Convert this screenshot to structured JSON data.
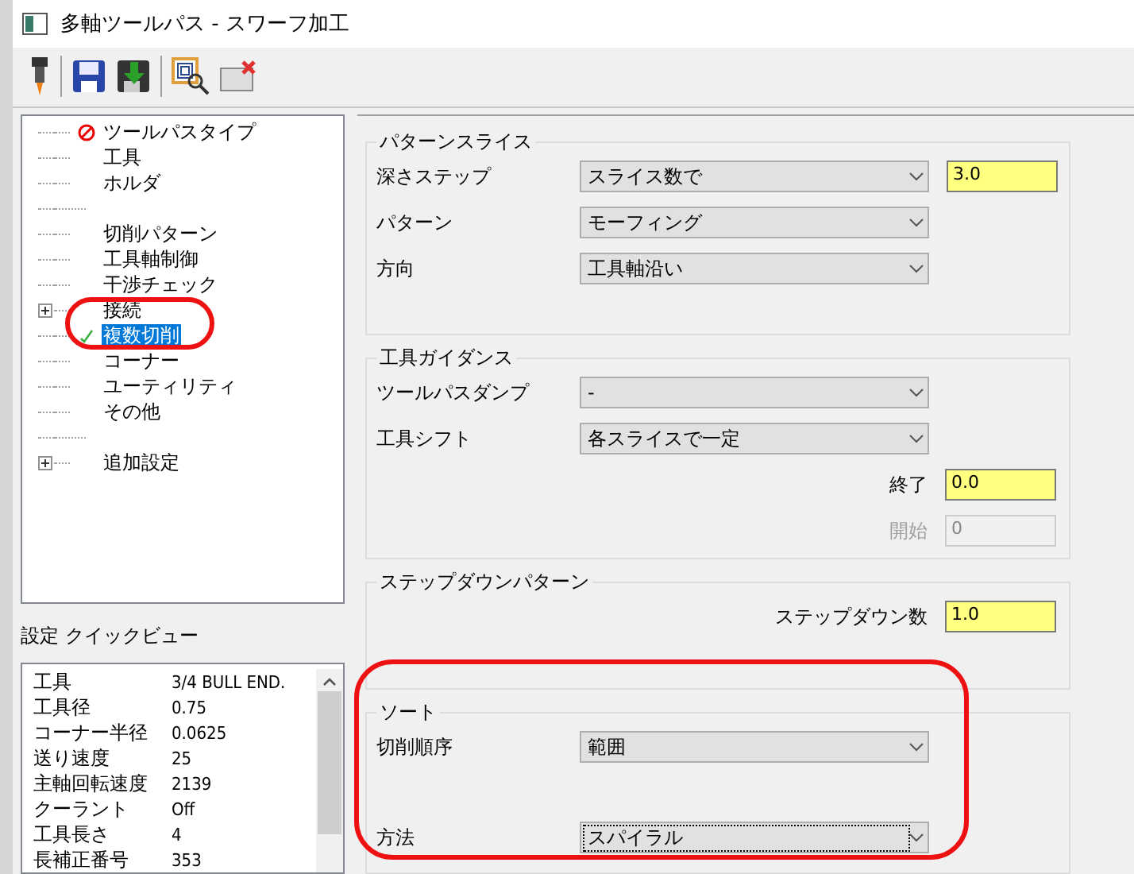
{
  "window": {
    "title": "多軸ツールパス - スワーフ加工"
  },
  "tree": {
    "items": [
      {
        "kind": "item",
        "label": "ツールパスタイプ",
        "invalid": true,
        "checked": false,
        "expandable": false,
        "selected": false
      },
      {
        "kind": "item",
        "label": "工具",
        "invalid": false,
        "checked": false,
        "expandable": false,
        "selected": false
      },
      {
        "kind": "item",
        "label": "ホルダ",
        "invalid": false,
        "checked": false,
        "expandable": false,
        "selected": false
      },
      {
        "kind": "blank",
        "expandable": false,
        "selected": false
      },
      {
        "kind": "item",
        "label": "切削パターン",
        "invalid": false,
        "checked": false,
        "expandable": false,
        "selected": false
      },
      {
        "kind": "item",
        "label": "工具軸制御",
        "invalid": false,
        "checked": false,
        "expandable": false,
        "selected": false
      },
      {
        "kind": "item",
        "label": "干渉チェック",
        "invalid": false,
        "checked": false,
        "expandable": false,
        "selected": false
      },
      {
        "kind": "item",
        "label": "接続",
        "invalid": false,
        "checked": false,
        "expandable": true,
        "selected": false
      },
      {
        "kind": "item",
        "label": "複数切削",
        "invalid": false,
        "checked": true,
        "expandable": false,
        "selected": true
      },
      {
        "kind": "item",
        "label": "コーナー",
        "invalid": false,
        "checked": false,
        "expandable": false,
        "selected": false
      },
      {
        "kind": "item",
        "label": "ユーティリティ",
        "invalid": false,
        "checked": false,
        "expandable": false,
        "selected": false
      },
      {
        "kind": "item",
        "label": "その他",
        "invalid": false,
        "checked": false,
        "expandable": false,
        "selected": false
      },
      {
        "kind": "blank",
        "expandable": false,
        "selected": false
      },
      {
        "kind": "item",
        "label": "追加設定",
        "invalid": false,
        "checked": false,
        "expandable": true,
        "selected": false
      }
    ]
  },
  "quick_view": {
    "title": "設定 クイックビュー",
    "rows": [
      {
        "name": "工具",
        "value": "3/4 BULL END."
      },
      {
        "name": "工具径",
        "value": "0.75"
      },
      {
        "name": "コーナー半径",
        "value": "0.0625"
      },
      {
        "name": "送り速度",
        "value": "25"
      },
      {
        "name": "主軸回転速度",
        "value": "2139"
      },
      {
        "name": "クーラント",
        "value": "Off"
      },
      {
        "name": "工具長さ",
        "value": "4"
      },
      {
        "name": "長補正番号",
        "value": "353"
      }
    ]
  },
  "sections": [
    {
      "title": "パターンスライス",
      "rows": [
        {
          "kind": "select",
          "label": "深さステップ",
          "value": "スライス数で",
          "focused": false,
          "field": "3.0"
        },
        {
          "kind": "select",
          "label": "パターン",
          "value": "モーフィング",
          "focused": false
        },
        {
          "kind": "select",
          "label": "方向",
          "value": "工具軸沿い",
          "focused": false
        }
      ]
    },
    {
      "title": "工具ガイダンス",
      "rows": [
        {
          "kind": "select",
          "label": "ツールパスダンプ",
          "value": "-",
          "focused": false
        },
        {
          "kind": "select",
          "label": "工具シフト",
          "value": "各スライスで一定",
          "focused": false
        },
        {
          "kind": "field",
          "label": "終了",
          "value": "0.0",
          "disabled": false
        },
        {
          "kind": "field",
          "label": "開始",
          "value": "0",
          "disabled": true
        }
      ]
    },
    {
      "title": "ステップダウンパターン",
      "rows": [
        {
          "kind": "field",
          "label": "ステップダウン数",
          "value": "1.0",
          "disabled": false
        }
      ]
    },
    {
      "title": "ソート",
      "rows": [
        {
          "kind": "select",
          "label": "切削順序",
          "value": "範囲",
          "focused": false
        },
        {
          "kind": "select",
          "label": "方法",
          "value": "スパイラル",
          "focused": true
        }
      ]
    }
  ]
}
